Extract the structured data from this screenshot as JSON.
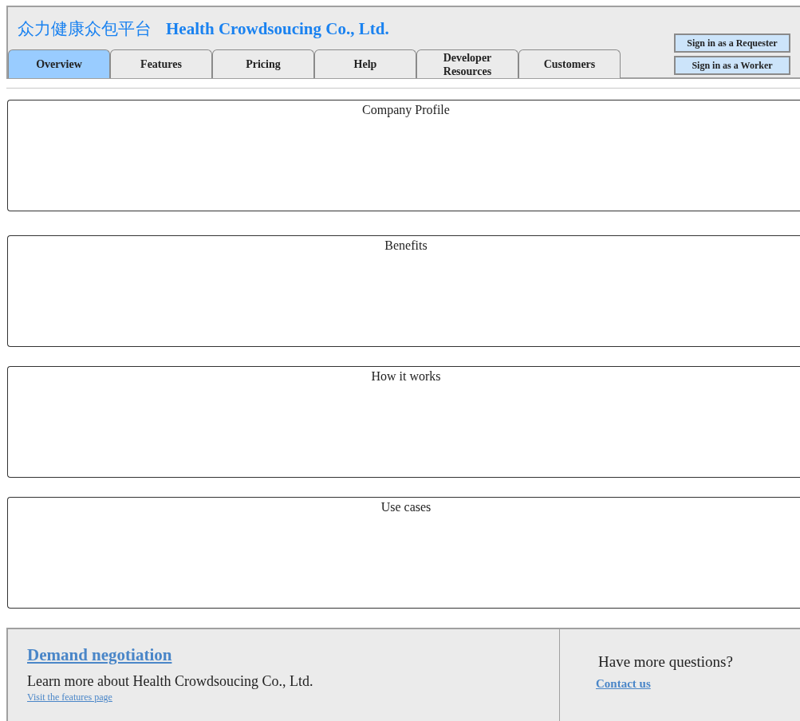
{
  "header": {
    "title_cn": "众力健康众包平台",
    "title_en": "Health Crowdsoucing Co., Ltd."
  },
  "tabs": [
    {
      "label": "Overview",
      "selected": true
    },
    {
      "label": "Features",
      "selected": false
    },
    {
      "label": "Pricing",
      "selected": false
    },
    {
      "label": "Help",
      "selected": false
    },
    {
      "label": "Developer Resources",
      "selected": false
    },
    {
      "label": "Customers",
      "selected": false
    }
  ],
  "sign_in_buttons": [
    "Sign in as a Requester",
    "Sign in as a Worker"
  ],
  "sections": [
    {
      "title": "Company Profile"
    },
    {
      "title": "Benefits"
    },
    {
      "title": "How it works"
    },
    {
      "title": "Use cases"
    }
  ],
  "footer": {
    "heading": "Demand negotiation",
    "text": "Learn more about Health Crowdsoucing Co., Ltd.",
    "link": "Visit the features page",
    "question": "Have more questions?",
    "contact": "Contact us"
  }
}
